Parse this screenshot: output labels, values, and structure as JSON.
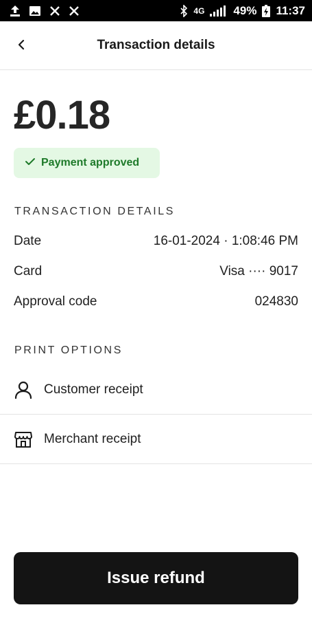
{
  "status_bar": {
    "network": "4G",
    "battery": "49%",
    "time": "11:37",
    "icons": [
      "upload-icon",
      "image-icon",
      "x-logo-icon",
      "x-logo-icon",
      "bluetooth-icon",
      "signal-icon",
      "battery-icon"
    ]
  },
  "appbar": {
    "title": "Transaction details"
  },
  "transaction": {
    "amount": "£0.18",
    "status": "Payment approved"
  },
  "details": {
    "heading": "TRANSACTION DETAILS",
    "rows": [
      {
        "label": "Date",
        "value": "16-01-2024 · 1:08:46 PM"
      },
      {
        "label": "Card",
        "value": "Visa ···· 9017"
      },
      {
        "label": "Approval code",
        "value": "024830"
      }
    ]
  },
  "print_options": {
    "heading": "PRINT OPTIONS",
    "items": [
      {
        "label": "Customer receipt",
        "icon": "person-icon"
      },
      {
        "label": "Merchant receipt",
        "icon": "store-icon"
      }
    ]
  },
  "actions": {
    "refund_label": "Issue refund"
  },
  "colors": {
    "badge_bg": "#e4f8e4",
    "badge_text": "#1e7a2a",
    "button_bg": "#141414"
  }
}
